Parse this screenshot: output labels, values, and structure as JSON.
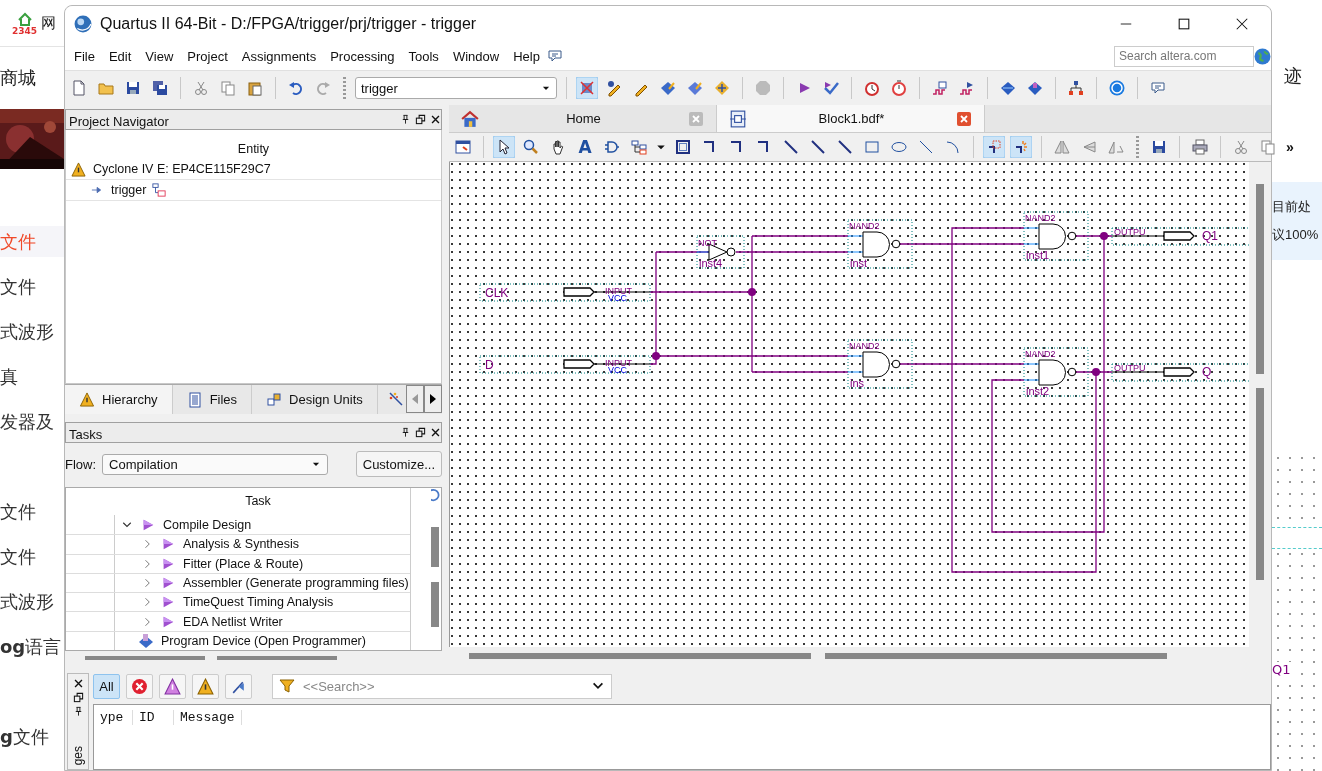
{
  "background_page": {
    "logo_text": "2345",
    "site_text": "网",
    "top_link": "商城",
    "left_groups": [
      {
        "items": [
          {
            "label": "文件",
            "selected": true
          },
          {
            "label": "文件",
            "selected": false
          },
          {
            "label": "式波形",
            "selected": false
          },
          {
            "label": "真",
            "selected": false
          },
          {
            "label": "发器及",
            "selected": false
          }
        ]
      },
      {
        "items": [
          {
            "label": "文件",
            "selected": false
          },
          {
            "label": "文件",
            "selected": false
          },
          {
            "label": "式波形",
            "selected": false
          },
          {
            "label": "**og**语言",
            "selected": false
          }
        ]
      },
      {
        "items": [
          {
            "label": "**g**文件",
            "selected": false
          }
        ]
      }
    ],
    "right_top": "迹",
    "notice": [
      "目前处",
      "议100%"
    ],
    "preview_label": "Q1"
  },
  "window": {
    "title": "Quartus II 64-Bit - D:/FPGA/trigger/prj/trigger - trigger"
  },
  "menu": [
    "File",
    "Edit",
    "View",
    "Project",
    "Assignments",
    "Processing",
    "Tools",
    "Window",
    "Help"
  ],
  "search": {
    "placeholder": "Search altera.com"
  },
  "main_toolbar": [
    {
      "kind": "new",
      "selected": false
    },
    {
      "kind": "open",
      "selected": false
    },
    {
      "kind": "save",
      "selected": false
    },
    {
      "kind": "saveall",
      "selected": false
    },
    {
      "kind": "sep"
    },
    {
      "kind": "cut",
      "selected": false
    },
    {
      "kind": "copy",
      "selected": false
    },
    {
      "kind": "paste",
      "selected": false
    },
    {
      "kind": "sep"
    },
    {
      "kind": "undo",
      "selected": false
    },
    {
      "kind": "redo",
      "selected": false
    },
    {
      "kind": "grip"
    },
    {
      "kind": "project",
      "value": "trigger"
    },
    {
      "kind": "sep"
    },
    {
      "kind": "netlist",
      "selected": true
    },
    {
      "kind": "assign",
      "selected": false
    },
    {
      "kind": "pin",
      "selected": false
    },
    {
      "kind": "compile",
      "selected": false
    },
    {
      "kind": "chip",
      "selected": false
    },
    {
      "kind": "fit",
      "selected": false
    },
    {
      "kind": "sep"
    },
    {
      "kind": "stop",
      "selected": false
    },
    {
      "kind": "sep"
    },
    {
      "kind": "start",
      "selected": false
    },
    {
      "kind": "verify",
      "selected": false
    },
    {
      "kind": "sep"
    },
    {
      "kind": "timer",
      "selected": false
    },
    {
      "kind": "stopwatch",
      "selected": false
    },
    {
      "kind": "sep"
    },
    {
      "kind": "wave",
      "selected": false
    },
    {
      "kind": "simulate",
      "selected": false
    },
    {
      "kind": "sep"
    },
    {
      "kind": "program",
      "selected": false
    },
    {
      "kind": "powerplay",
      "selected": false
    },
    {
      "kind": "sep"
    },
    {
      "kind": "rtl",
      "selected": false
    },
    {
      "kind": "sep"
    },
    {
      "kind": "help",
      "selected": false
    },
    {
      "kind": "sep"
    },
    {
      "kind": "feedback",
      "selected": false
    }
  ],
  "project_navigator": {
    "title": "Project Navigator",
    "column": "Entity",
    "tree": [
      {
        "label": "Cyclone IV E: EP4CE115F29C7",
        "children": [
          {
            "label": "trigger"
          }
        ]
      }
    ],
    "tabs": [
      {
        "label": "Hierarchy",
        "selected": true
      },
      {
        "label": "Files",
        "selected": false
      },
      {
        "label": "Design Units",
        "selected": false
      }
    ]
  },
  "tasks": {
    "title": "Tasks",
    "flow_label": "Flow:",
    "flow_value": "Compilation",
    "customize": "Customize...",
    "column": "Task",
    "tree": [
      {
        "label": "Compile Design",
        "expanded": true,
        "children": [
          {
            "label": "Analysis & Synthesis",
            "expanded": false
          },
          {
            "label": "Fitter (Place & Route)",
            "expanded": false
          },
          {
            "label": "Assembler (Generate programming files)",
            "expanded": false
          },
          {
            "label": "TimeQuest Timing Analysis",
            "expanded": false
          },
          {
            "label": "EDA Netlist Writer",
            "expanded": false
          }
        ]
      },
      {
        "label": "Program Device (Open Programmer)"
      }
    ]
  },
  "editor_tabs": [
    {
      "label": "Home",
      "selected": false
    },
    {
      "label": "Block1.bdf*",
      "selected": true
    }
  ],
  "editor_toolbar": [
    {
      "kind": "window",
      "selected": false
    },
    {
      "kind": "sep"
    },
    {
      "kind": "pointer",
      "selected": true
    },
    {
      "kind": "zoom",
      "selected": false
    },
    {
      "kind": "hand",
      "selected": false
    },
    {
      "kind": "text",
      "label": "A",
      "selected": false
    },
    {
      "kind": "symbol",
      "selected": false
    },
    {
      "kind": "tree",
      "selected": false
    },
    {
      "kind": "caret"
    },
    {
      "kind": "frame",
      "selected": false
    },
    {
      "kind": "ortho",
      "selected": false
    },
    {
      "kind": "ortho",
      "selected": false
    },
    {
      "kind": "ortho",
      "selected": false
    },
    {
      "kind": "diag",
      "selected": false
    },
    {
      "kind": "diag",
      "selected": false
    },
    {
      "kind": "diag",
      "selected": false
    },
    {
      "kind": "rect",
      "selected": false
    },
    {
      "kind": "ellipse",
      "selected": false
    },
    {
      "kind": "line",
      "selected": false
    },
    {
      "kind": "arc",
      "selected": false
    },
    {
      "kind": "sep"
    },
    {
      "kind": "rubber",
      "selected": true
    },
    {
      "kind": "partial",
      "selected": true
    },
    {
      "kind": "sep"
    },
    {
      "kind": "fliph",
      "selected": false
    },
    {
      "kind": "flipv",
      "selected": false
    },
    {
      "kind": "rotate",
      "selected": false
    },
    {
      "kind": "grip"
    },
    {
      "kind": "save",
      "selected": false
    },
    {
      "kind": "sep"
    },
    {
      "kind": "print",
      "selected": false
    },
    {
      "kind": "sep"
    },
    {
      "kind": "cut",
      "selected": false
    },
    {
      "kind": "copy",
      "selected": false
    },
    {
      "kind": "more",
      "label": "»"
    }
  ],
  "schematic": {
    "pins": [
      {
        "kind": "input",
        "name": "CLK",
        "type_label": "INPUT",
        "default_label": "VCC"
      },
      {
        "kind": "input",
        "name": "D",
        "type_label": "INPUT",
        "default_label": "VCC"
      },
      {
        "kind": "output",
        "name": "Q1",
        "type_label": "OUTPU"
      },
      {
        "kind": "output",
        "name": "Q",
        "type_label": "OUTPU"
      }
    ],
    "gates": [
      {
        "kind": "not",
        "type_label": "NOT",
        "instance": "inst4"
      },
      {
        "kind": "nand",
        "type_label": "NAND2",
        "instance": "inst"
      },
      {
        "kind": "nand",
        "type_label": "NAND2",
        "instance": "ins"
      },
      {
        "kind": "nand",
        "type_label": "NAND2",
        "instance": "inst1"
      },
      {
        "kind": "nand",
        "type_label": "NAND2",
        "instance": "inst2"
      }
    ]
  },
  "messages": {
    "side_label": "ges",
    "filters": [
      {
        "kind": "all",
        "label": "All",
        "selected": true
      },
      {
        "kind": "error",
        "selected": false
      },
      {
        "kind": "critical",
        "selected": false
      },
      {
        "kind": "warning",
        "selected": false
      },
      {
        "kind": "suppressed",
        "selected": false
      }
    ],
    "search": {
      "placeholder": "<<Search>>"
    },
    "columns": [
      "ype",
      "ID",
      "Message"
    ]
  }
}
